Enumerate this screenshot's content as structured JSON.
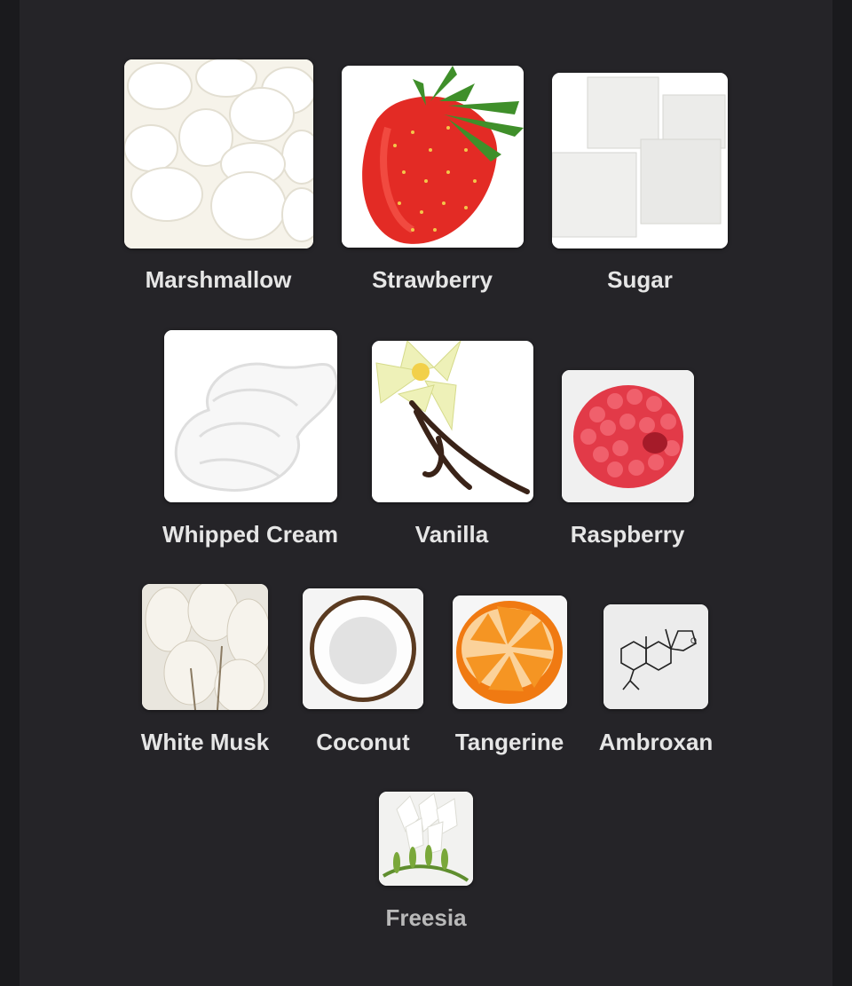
{
  "notes": [
    {
      "name": "Marshmallow",
      "icon": "marshmallow-image"
    },
    {
      "name": "Strawberry",
      "icon": "strawberry-image"
    },
    {
      "name": "Sugar",
      "icon": "sugar-cubes-image"
    },
    {
      "name": "Whipped Cream",
      "icon": "whipped-cream-image"
    },
    {
      "name": "Vanilla",
      "icon": "vanilla-flower-image"
    },
    {
      "name": "Raspberry",
      "icon": "raspberry-image"
    },
    {
      "name": "White Musk",
      "icon": "white-musk-image"
    },
    {
      "name": "Coconut",
      "icon": "coconut-image"
    },
    {
      "name": "Tangerine",
      "icon": "tangerine-image"
    },
    {
      "name": "Ambroxan",
      "icon": "ambroxan-molecule-image"
    },
    {
      "name": "Freesia",
      "icon": "freesia-flower-image"
    }
  ],
  "colors": {
    "background": "#1a1a1d",
    "panel": "#252428",
    "label": "#e6e6e6"
  }
}
